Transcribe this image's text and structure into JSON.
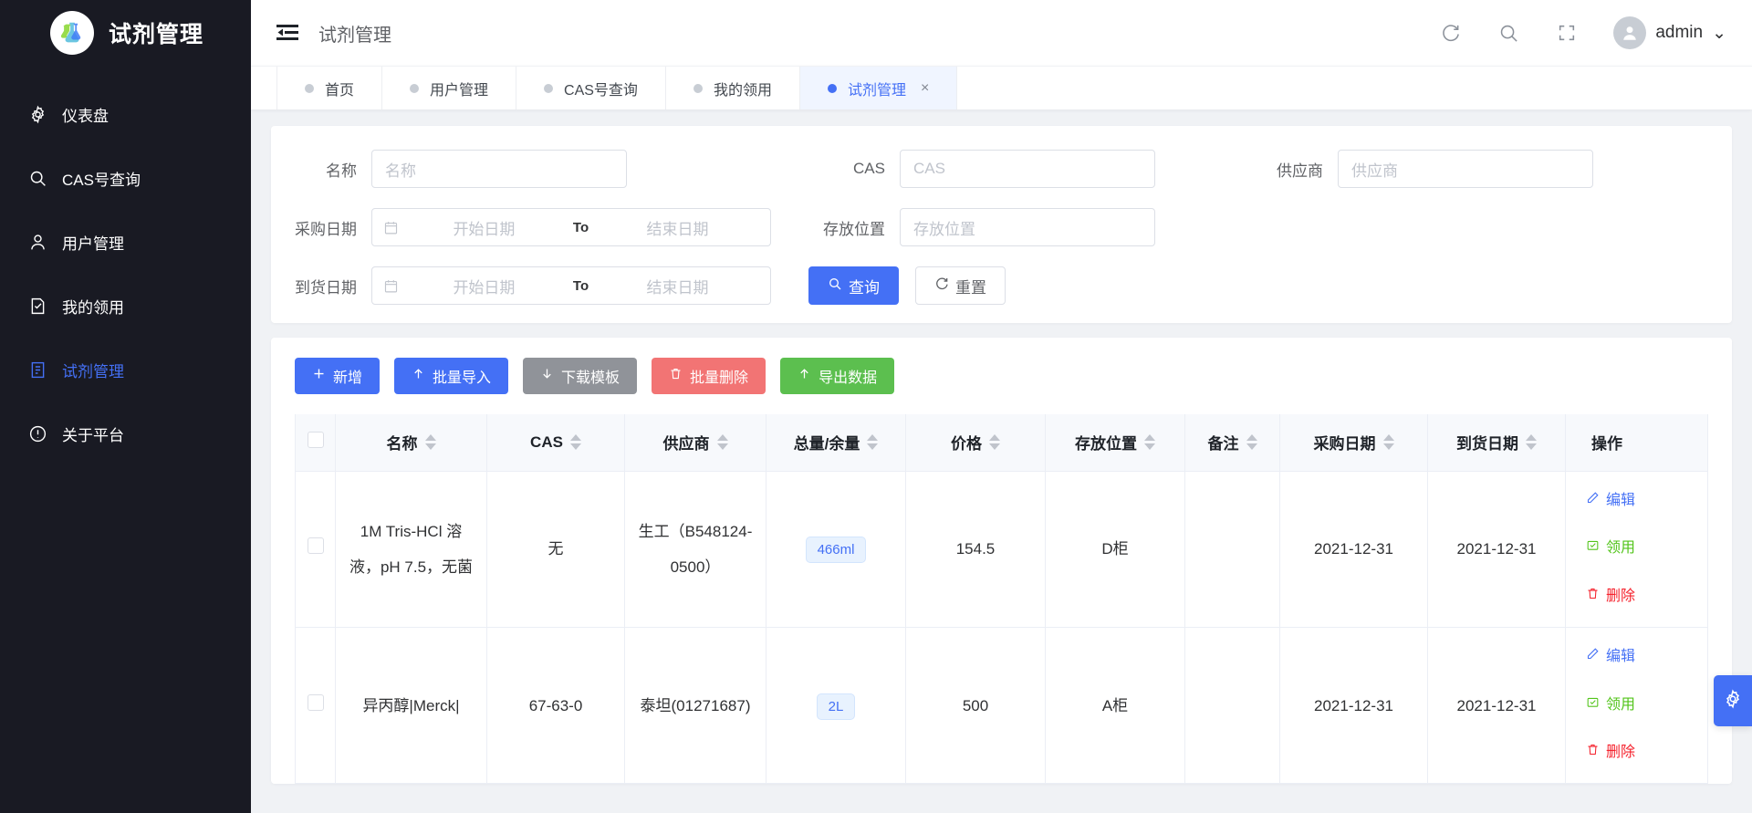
{
  "sidebar": {
    "brand_title": "试剂管理",
    "brand_logo_icon": "flask-icon",
    "items": [
      {
        "label": "仪表盘",
        "icon": "gear-icon",
        "active": false
      },
      {
        "label": "CAS号查询",
        "icon": "search-icon",
        "active": false
      },
      {
        "label": "用户管理",
        "icon": "user-icon",
        "active": false
      },
      {
        "label": "我的领用",
        "icon": "doc-check-icon",
        "active": false
      },
      {
        "label": "试剂管理",
        "icon": "doc-icon",
        "active": true
      },
      {
        "label": "关于平台",
        "icon": "info-icon",
        "active": false
      }
    ]
  },
  "topbar": {
    "collapse_icon": "menu-fold-icon",
    "page_title": "试剂管理",
    "refresh_icon": "refresh-icon",
    "search_icon": "search-icon",
    "fullscreen_icon": "fullscreen-icon",
    "avatar_icon": "avatar-icon",
    "user_name": "admin",
    "user_caret": "⌄"
  },
  "tabs": [
    {
      "label": "首页",
      "active": false,
      "closable": false
    },
    {
      "label": "用户管理",
      "active": false,
      "closable": false
    },
    {
      "label": "CAS号查询",
      "active": false,
      "closable": false
    },
    {
      "label": "我的领用",
      "active": false,
      "closable": false
    },
    {
      "label": "试剂管理",
      "active": true,
      "closable": true,
      "close_label": "×"
    }
  ],
  "search_form": {
    "name": {
      "label": "名称",
      "value": "",
      "placeholder": "名称"
    },
    "cas": {
      "label": "CAS",
      "value": "",
      "placeholder": "CAS"
    },
    "supplier": {
      "label": "供应商",
      "value": "",
      "placeholder": "供应商"
    },
    "purchase_date": {
      "label": "采购日期",
      "start_placeholder": "开始日期",
      "separator": "To",
      "end_placeholder": "结束日期",
      "calendar_icon": "calendar-icon"
    },
    "storage": {
      "label": "存放位置",
      "value": "",
      "placeholder": "存放位置"
    },
    "arrival_date": {
      "label": "到货日期",
      "start_placeholder": "开始日期",
      "separator": "To",
      "end_placeholder": "结束日期",
      "calendar_icon": "calendar-icon"
    },
    "search_button": {
      "label": "查询",
      "icon": "search-icon",
      "color": "#4470f5"
    },
    "reset_button": {
      "label": "重置",
      "icon": "refresh-icon"
    }
  },
  "toolbar": {
    "buttons": [
      {
        "label": "新增",
        "icon": "plus-icon",
        "color": "#4470f5"
      },
      {
        "label": "批量导入",
        "icon": "upload-icon",
        "color": "#4470f5"
      },
      {
        "label": "下载模板",
        "icon": "download-icon",
        "color": "#909399"
      },
      {
        "label": "批量删除",
        "icon": "trash-icon",
        "color": "#f27474"
      },
      {
        "label": "导出数据",
        "icon": "upload-icon",
        "color": "#5cbf4f"
      }
    ]
  },
  "table": {
    "select_all_checkbox": "",
    "columns": [
      {
        "label": "名称",
        "sortable": true
      },
      {
        "label": "CAS",
        "sortable": true
      },
      {
        "label": "供应商",
        "sortable": true
      },
      {
        "label": "总量/余量",
        "sortable": true
      },
      {
        "label": "价格",
        "sortable": true
      },
      {
        "label": "存放位置",
        "sortable": true
      },
      {
        "label": "备注",
        "sortable": true
      },
      {
        "label": "采购日期",
        "sortable": true
      },
      {
        "label": "到货日期",
        "sortable": true
      },
      {
        "label": "操作",
        "sortable": false
      }
    ],
    "rows": [
      {
        "name": "1M Tris-HCl 溶液，pH 7.5，无菌",
        "cas": "无",
        "supplier": "生工（B548124-0500）",
        "amount": "466ml",
        "price": "154.5",
        "storage": "D柜",
        "remark": "",
        "purchase_date": "2021-12-31",
        "arrival_date": "2021-12-31",
        "ops": [
          {
            "label": "编辑",
            "icon": "pencil-icon",
            "kind": "edit"
          },
          {
            "label": "领用",
            "icon": "receive-icon",
            "kind": "use"
          },
          {
            "label": "删除",
            "icon": "trash-icon",
            "kind": "del"
          }
        ]
      },
      {
        "name": "异丙醇|Merck|",
        "cas": "67-63-0",
        "supplier": "泰坦(01271687)",
        "amount": "2L",
        "price": "500",
        "storage": "A柜",
        "remark": "",
        "purchase_date": "2021-12-31",
        "arrival_date": "2021-12-31",
        "ops": [
          {
            "label": "编辑",
            "icon": "pencil-icon",
            "kind": "edit"
          },
          {
            "label": "领用",
            "icon": "receive-icon",
            "kind": "use"
          },
          {
            "label": "删除",
            "icon": "trash-icon",
            "kind": "del"
          }
        ]
      }
    ]
  },
  "floating_settings": {
    "icon": "gear-icon",
    "color": "#4470f5"
  }
}
